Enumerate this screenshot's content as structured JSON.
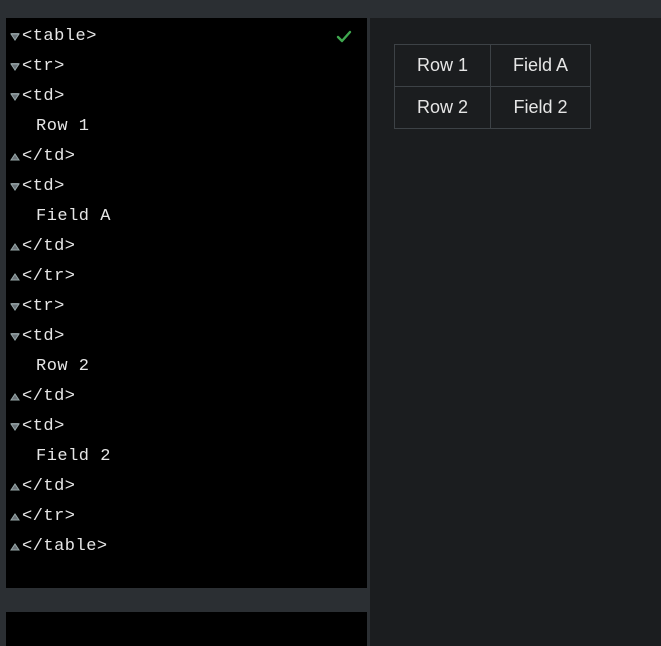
{
  "code": {
    "lines": [
      {
        "fold": "down",
        "text": "<table>",
        "indent": false
      },
      {
        "fold": "none",
        "text": "",
        "indent": false
      },
      {
        "fold": "down",
        "text": "<tr>",
        "indent": false
      },
      {
        "fold": "down",
        "text": "<td>",
        "indent": false
      },
      {
        "fold": "none",
        "text": "Row 1",
        "indent": true
      },
      {
        "fold": "up",
        "text": "</td>",
        "indent": false
      },
      {
        "fold": "down",
        "text": "<td>",
        "indent": false
      },
      {
        "fold": "none",
        "text": "Field A",
        "indent": true
      },
      {
        "fold": "up",
        "text": "</td>",
        "indent": false
      },
      {
        "fold": "up",
        "text": "</tr>",
        "indent": false
      },
      {
        "fold": "none",
        "text": "",
        "indent": false
      },
      {
        "fold": "down",
        "text": "<tr>",
        "indent": false
      },
      {
        "fold": "down",
        "text": "<td>",
        "indent": false
      },
      {
        "fold": "none",
        "text": "Row 2",
        "indent": true
      },
      {
        "fold": "up",
        "text": "</td>",
        "indent": false
      },
      {
        "fold": "down",
        "text": "<td>",
        "indent": false
      },
      {
        "fold": "none",
        "text": "Field 2",
        "indent": true
      },
      {
        "fold": "up",
        "text": "</td>",
        "indent": false
      },
      {
        "fold": "up",
        "text": "</tr>",
        "indent": false
      },
      {
        "fold": "up",
        "text": "</table>",
        "indent": false
      }
    ]
  },
  "preview": {
    "rows": [
      [
        "Row 1",
        "Field A"
      ],
      [
        "Row 2",
        "Field 2"
      ]
    ]
  }
}
